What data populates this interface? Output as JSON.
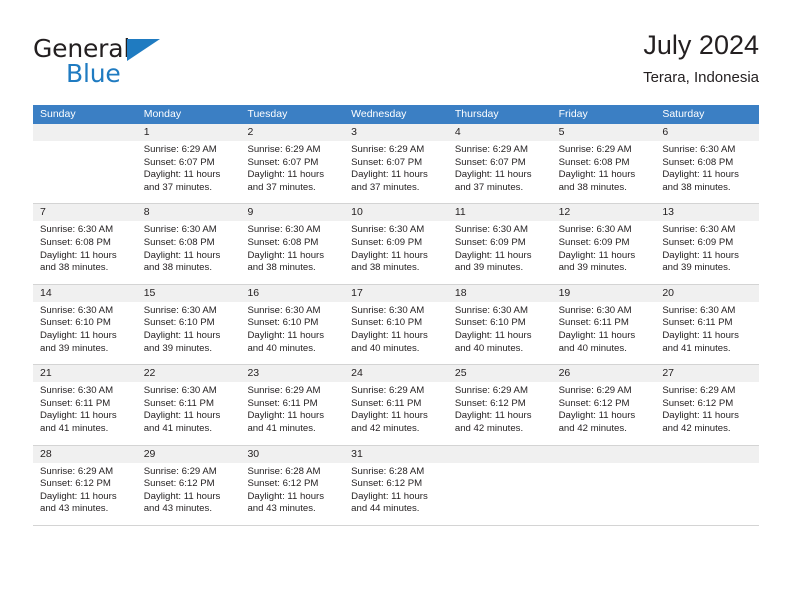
{
  "brand": {
    "name_dark": "General",
    "name_blue": "Blue",
    "accent_color": "#1f7bc1"
  },
  "header": {
    "title": "July 2024",
    "location": "Terara, Indonesia"
  },
  "theme": {
    "header_row_bg": "#3b7fc4",
    "day_number_bg": "#f0f0f0",
    "grid_line": "#d4d4d4",
    "text": "#231f20"
  },
  "weekdays": [
    "Sunday",
    "Monday",
    "Tuesday",
    "Wednesday",
    "Thursday",
    "Friday",
    "Saturday"
  ],
  "weeks": [
    [
      {
        "day": "",
        "sunrise": "",
        "sunset": "",
        "daylight_1": "",
        "daylight_2": ""
      },
      {
        "day": "1",
        "sunrise": "Sunrise: 6:29 AM",
        "sunset": "Sunset: 6:07 PM",
        "daylight_1": "Daylight: 11 hours",
        "daylight_2": "and 37 minutes."
      },
      {
        "day": "2",
        "sunrise": "Sunrise: 6:29 AM",
        "sunset": "Sunset: 6:07 PM",
        "daylight_1": "Daylight: 11 hours",
        "daylight_2": "and 37 minutes."
      },
      {
        "day": "3",
        "sunrise": "Sunrise: 6:29 AM",
        "sunset": "Sunset: 6:07 PM",
        "daylight_1": "Daylight: 11 hours",
        "daylight_2": "and 37 minutes."
      },
      {
        "day": "4",
        "sunrise": "Sunrise: 6:29 AM",
        "sunset": "Sunset: 6:07 PM",
        "daylight_1": "Daylight: 11 hours",
        "daylight_2": "and 37 minutes."
      },
      {
        "day": "5",
        "sunrise": "Sunrise: 6:29 AM",
        "sunset": "Sunset: 6:08 PM",
        "daylight_1": "Daylight: 11 hours",
        "daylight_2": "and 38 minutes."
      },
      {
        "day": "6",
        "sunrise": "Sunrise: 6:30 AM",
        "sunset": "Sunset: 6:08 PM",
        "daylight_1": "Daylight: 11 hours",
        "daylight_2": "and 38 minutes."
      }
    ],
    [
      {
        "day": "7",
        "sunrise": "Sunrise: 6:30 AM",
        "sunset": "Sunset: 6:08 PM",
        "daylight_1": "Daylight: 11 hours",
        "daylight_2": "and 38 minutes."
      },
      {
        "day": "8",
        "sunrise": "Sunrise: 6:30 AM",
        "sunset": "Sunset: 6:08 PM",
        "daylight_1": "Daylight: 11 hours",
        "daylight_2": "and 38 minutes."
      },
      {
        "day": "9",
        "sunrise": "Sunrise: 6:30 AM",
        "sunset": "Sunset: 6:08 PM",
        "daylight_1": "Daylight: 11 hours",
        "daylight_2": "and 38 minutes."
      },
      {
        "day": "10",
        "sunrise": "Sunrise: 6:30 AM",
        "sunset": "Sunset: 6:09 PM",
        "daylight_1": "Daylight: 11 hours",
        "daylight_2": "and 38 minutes."
      },
      {
        "day": "11",
        "sunrise": "Sunrise: 6:30 AM",
        "sunset": "Sunset: 6:09 PM",
        "daylight_1": "Daylight: 11 hours",
        "daylight_2": "and 39 minutes."
      },
      {
        "day": "12",
        "sunrise": "Sunrise: 6:30 AM",
        "sunset": "Sunset: 6:09 PM",
        "daylight_1": "Daylight: 11 hours",
        "daylight_2": "and 39 minutes."
      },
      {
        "day": "13",
        "sunrise": "Sunrise: 6:30 AM",
        "sunset": "Sunset: 6:09 PM",
        "daylight_1": "Daylight: 11 hours",
        "daylight_2": "and 39 minutes."
      }
    ],
    [
      {
        "day": "14",
        "sunrise": "Sunrise: 6:30 AM",
        "sunset": "Sunset: 6:10 PM",
        "daylight_1": "Daylight: 11 hours",
        "daylight_2": "and 39 minutes."
      },
      {
        "day": "15",
        "sunrise": "Sunrise: 6:30 AM",
        "sunset": "Sunset: 6:10 PM",
        "daylight_1": "Daylight: 11 hours",
        "daylight_2": "and 39 minutes."
      },
      {
        "day": "16",
        "sunrise": "Sunrise: 6:30 AM",
        "sunset": "Sunset: 6:10 PM",
        "daylight_1": "Daylight: 11 hours",
        "daylight_2": "and 40 minutes."
      },
      {
        "day": "17",
        "sunrise": "Sunrise: 6:30 AM",
        "sunset": "Sunset: 6:10 PM",
        "daylight_1": "Daylight: 11 hours",
        "daylight_2": "and 40 minutes."
      },
      {
        "day": "18",
        "sunrise": "Sunrise: 6:30 AM",
        "sunset": "Sunset: 6:10 PM",
        "daylight_1": "Daylight: 11 hours",
        "daylight_2": "and 40 minutes."
      },
      {
        "day": "19",
        "sunrise": "Sunrise: 6:30 AM",
        "sunset": "Sunset: 6:11 PM",
        "daylight_1": "Daylight: 11 hours",
        "daylight_2": "and 40 minutes."
      },
      {
        "day": "20",
        "sunrise": "Sunrise: 6:30 AM",
        "sunset": "Sunset: 6:11 PM",
        "daylight_1": "Daylight: 11 hours",
        "daylight_2": "and 41 minutes."
      }
    ],
    [
      {
        "day": "21",
        "sunrise": "Sunrise: 6:30 AM",
        "sunset": "Sunset: 6:11 PM",
        "daylight_1": "Daylight: 11 hours",
        "daylight_2": "and 41 minutes."
      },
      {
        "day": "22",
        "sunrise": "Sunrise: 6:30 AM",
        "sunset": "Sunset: 6:11 PM",
        "daylight_1": "Daylight: 11 hours",
        "daylight_2": "and 41 minutes."
      },
      {
        "day": "23",
        "sunrise": "Sunrise: 6:29 AM",
        "sunset": "Sunset: 6:11 PM",
        "daylight_1": "Daylight: 11 hours",
        "daylight_2": "and 41 minutes."
      },
      {
        "day": "24",
        "sunrise": "Sunrise: 6:29 AM",
        "sunset": "Sunset: 6:11 PM",
        "daylight_1": "Daylight: 11 hours",
        "daylight_2": "and 42 minutes."
      },
      {
        "day": "25",
        "sunrise": "Sunrise: 6:29 AM",
        "sunset": "Sunset: 6:12 PM",
        "daylight_1": "Daylight: 11 hours",
        "daylight_2": "and 42 minutes."
      },
      {
        "day": "26",
        "sunrise": "Sunrise: 6:29 AM",
        "sunset": "Sunset: 6:12 PM",
        "daylight_1": "Daylight: 11 hours",
        "daylight_2": "and 42 minutes."
      },
      {
        "day": "27",
        "sunrise": "Sunrise: 6:29 AM",
        "sunset": "Sunset: 6:12 PM",
        "daylight_1": "Daylight: 11 hours",
        "daylight_2": "and 42 minutes."
      }
    ],
    [
      {
        "day": "28",
        "sunrise": "Sunrise: 6:29 AM",
        "sunset": "Sunset: 6:12 PM",
        "daylight_1": "Daylight: 11 hours",
        "daylight_2": "and 43 minutes."
      },
      {
        "day": "29",
        "sunrise": "Sunrise: 6:29 AM",
        "sunset": "Sunset: 6:12 PM",
        "daylight_1": "Daylight: 11 hours",
        "daylight_2": "and 43 minutes."
      },
      {
        "day": "30",
        "sunrise": "Sunrise: 6:28 AM",
        "sunset": "Sunset: 6:12 PM",
        "daylight_1": "Daylight: 11 hours",
        "daylight_2": "and 43 minutes."
      },
      {
        "day": "31",
        "sunrise": "Sunrise: 6:28 AM",
        "sunset": "Sunset: 6:12 PM",
        "daylight_1": "Daylight: 11 hours",
        "daylight_2": "and 44 minutes."
      },
      {
        "day": "",
        "sunrise": "",
        "sunset": "",
        "daylight_1": "",
        "daylight_2": ""
      },
      {
        "day": "",
        "sunrise": "",
        "sunset": "",
        "daylight_1": "",
        "daylight_2": ""
      },
      {
        "day": "",
        "sunrise": "",
        "sunset": "",
        "daylight_1": "",
        "daylight_2": ""
      }
    ]
  ]
}
